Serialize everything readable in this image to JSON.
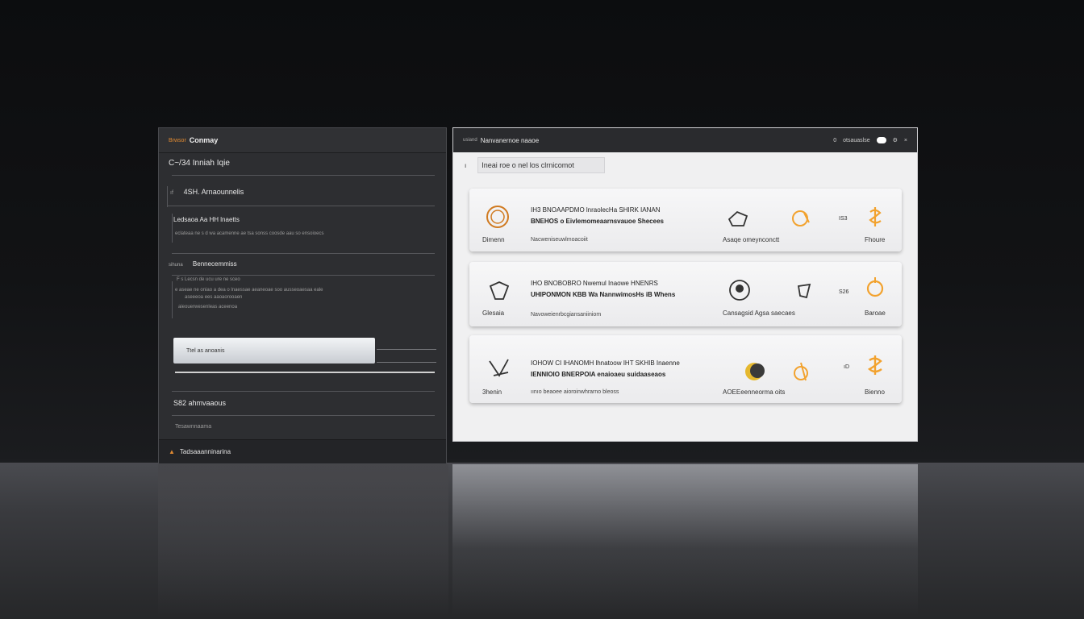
{
  "left_panel": {
    "brand": "Brwsor",
    "title": "Conmay",
    "item1": "C~/34 Inniah Iqie",
    "item2_prefix": "ıf",
    "item2": "4SH. Arnaounnelis",
    "item3": "Ledsaoa Aa HH lnaetts",
    "item3_desc": "eclateaa ne s d wa acamenne ae tsa sonss coosde aau so ensoioecs",
    "item4_prefix": "sihuna",
    "item4": "Bennecemmiss",
    "item4_desc1": "F s Lecsn de ucu ure ne sceo",
    "item4_desc2": "e aseae ne oniao a dea o lnaessae aeaneoae soo ausseoaesaa eale",
    "item4_desc3": "aseeeoa ees aaoaorooaen",
    "item4_desc4": "aieouerwesenleas aceenoa",
    "input_value": "Ttel as anoanis",
    "item5": "S82 ahmvaaous",
    "item6": "Tesawnnaama",
    "footer": "Tadsaaanninarina"
  },
  "right_panel": {
    "header_small": "usiand",
    "header_title": "Nanvanernoe naaoe",
    "header_right_1": "0",
    "header_right_2": "otsauaslse",
    "search_prefix": "ı",
    "search_value": "Ineai roe o nel los clrnicomot",
    "colors": {
      "accent": "#f2a22e",
      "dark": "#2a2b2e"
    },
    "cards": [
      {
        "left_label": "Dimenn",
        "title_line1": "IH3 BNOAAPDMO lnraolecHa SHIRK IANAN",
        "title_line2": "BNEHOS o Eivlemomeaarnsvauoe Shecees",
        "subtitle": "Nacweniseuwlmoacoiit",
        "mid_label": "Asaqe omeynconctt",
        "price": "IS3",
        "right_label": "Fhoure",
        "icon_left": "coin-icon",
        "icon_mid": "chat-bubble-icon",
        "icon_right": "dollar-coin-icon"
      },
      {
        "left_label": "Glesaia",
        "title_line1": "IHO BNOBOBRO Nwemul Inaowe HNENRS",
        "title_line2": "UHIPONMON KBB Wa NannwimosHs iB Whens",
        "subtitle": "Navoweienrbcgiansaniiniom",
        "mid_label": "Cansagsid Agsa saecaes",
        "price": "S26",
        "right_label": "Baroae",
        "icon_left": "shield-icon",
        "icon_mid": "lens-icon",
        "icon_right": "bell-icon"
      },
      {
        "left_label": "3henin",
        "title_line1": "IOHOW CI IHANOMH lhnatoow IHT SKHIB Inaenne",
        "title_line2": "IENNIOIO BNERPOIA enaioaeu suidaaseaos",
        "subtitle": "ıınıo beaoee aioroinwhrarno bleoss",
        "mid_label": "AOEEeenneorma oits",
        "price": "ıD",
        "right_label": "Bienno",
        "icon_left": "compass-icon",
        "icon_mid": "moon-icon",
        "icon_right": "coins-icon"
      }
    ]
  }
}
